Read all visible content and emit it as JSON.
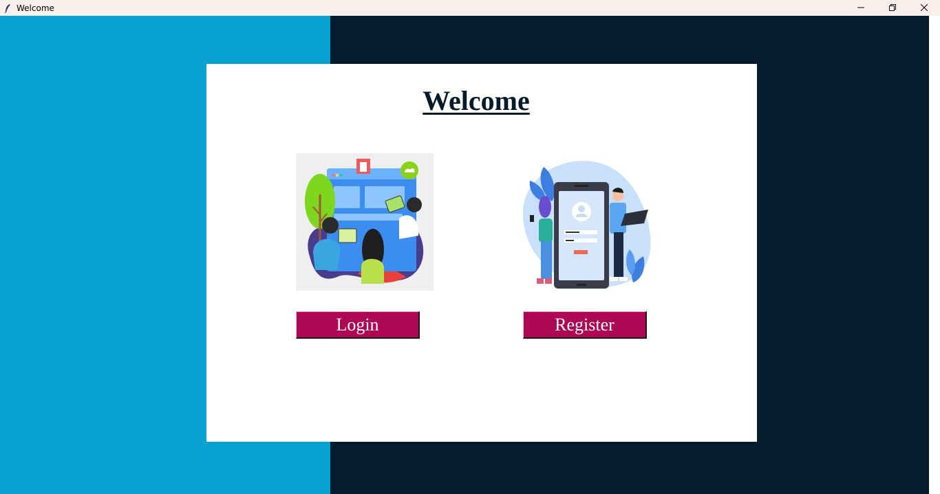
{
  "window": {
    "title": "Welcome",
    "app_icon": "feather-icon",
    "controls": [
      "minimize-icon",
      "restore-icon",
      "close-icon"
    ]
  },
  "colors": {
    "titlebar_bg": "#f9f0ec",
    "left_bg": "#07a2d2",
    "right_bg": "#041c2e",
    "panel_bg": "#ffffff",
    "title_text": "#051b2c",
    "button_bg": "#ae0753",
    "button_text": "#ffffff"
  },
  "panel": {
    "heading": "Welcome",
    "login": {
      "illustration": "team-working-illustration",
      "button_label": "Login"
    },
    "register": {
      "illustration": "mobile-signup-illustration",
      "button_label": "Register"
    }
  }
}
